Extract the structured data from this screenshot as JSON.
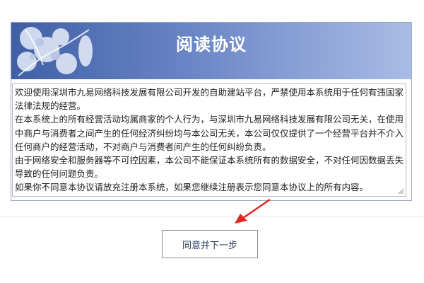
{
  "agreement": {
    "title": "阅读协议",
    "paragraphs": [
      "欢迎使用深圳市九易网络科技发展有限公司开发的自助建站平台，严禁使用本系统用于任何有违国家法律法规的经营。",
      "在本系统上的所有经营活动均属商家的个人行为，与深圳市九易网络科技发展有限公司无关，在使用中商户与消费者之间产生的任何经济纠纷均与本公司无关，本公司仅仅提供了一个经营平台并不介入任何商户的经营活动，不对商户与消费者间产生的任何纠纷负责。",
      "由于网络安全和服务器等不可控因素，本公司不能保证本系统所有的数据安全，不对任何因数据丢失导致的任何问题负责。",
      "如果你不同意本协议请放充注册本系统，如果您继续注册表示您同意本协议上的所有内容。"
    ]
  },
  "actions": {
    "agree_next_label": "同意并下一步"
  },
  "colors": {
    "header_dark": "#3f5fa6",
    "header_light": "#a9bce6",
    "arrow": "#e0281e"
  },
  "icons": {
    "header_decoration": "flower-decoration-icon",
    "annotation": "red-arrow-icon"
  }
}
